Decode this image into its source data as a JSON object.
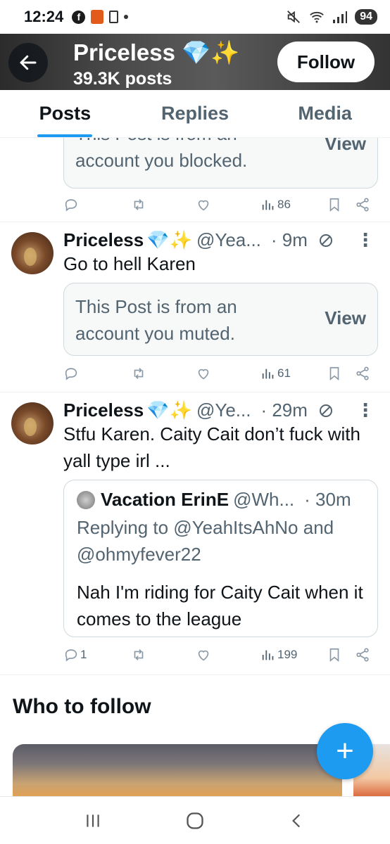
{
  "status_bar": {
    "time": "12:24",
    "fb_letter": "f",
    "battery": "94"
  },
  "header": {
    "title": "Priceless 💎✨",
    "subtitle": "39.3K posts",
    "follow_label": "Follow"
  },
  "tabs": [
    {
      "label": "Posts",
      "active": true
    },
    {
      "label": "Replies",
      "active": false
    },
    {
      "label": "Media",
      "active": false
    }
  ],
  "tweets": [
    {
      "notice_text": "This Post is from an account you blocked.",
      "notice_view": "View",
      "views": "86"
    },
    {
      "name": "Priceless",
      "emoji": "💎✨",
      "handle": "@Yea...",
      "time": "· 9m",
      "text": "Go to hell Karen",
      "notice_text": "This Post is from an account you muted.",
      "notice_view": "View",
      "views": "61"
    },
    {
      "name": "Priceless",
      "emoji": "💎✨",
      "handle": "@Ye...",
      "time": "· 29m",
      "text": "Stfu Karen. Caity Cait don’t fuck with yall type irl ...",
      "quote": {
        "name": "Vacation ErinE",
        "handle": "@Wh...",
        "time": "· 30m",
        "replying": "Replying to @YeahItsAhNo and @ohmyfever22",
        "text": "Nah I'm riding for Caity Cait when it comes to the league"
      },
      "replies": "1",
      "views": "199"
    }
  ],
  "who_to_follow": {
    "title": "Who to follow"
  },
  "fab_label": "+",
  "icons": [
    "back-arrow-icon",
    "reply-icon",
    "retweet-icon",
    "like-icon",
    "views-icon",
    "bookmark-icon",
    "share-icon",
    "no-bell-icon",
    "more-icon"
  ]
}
